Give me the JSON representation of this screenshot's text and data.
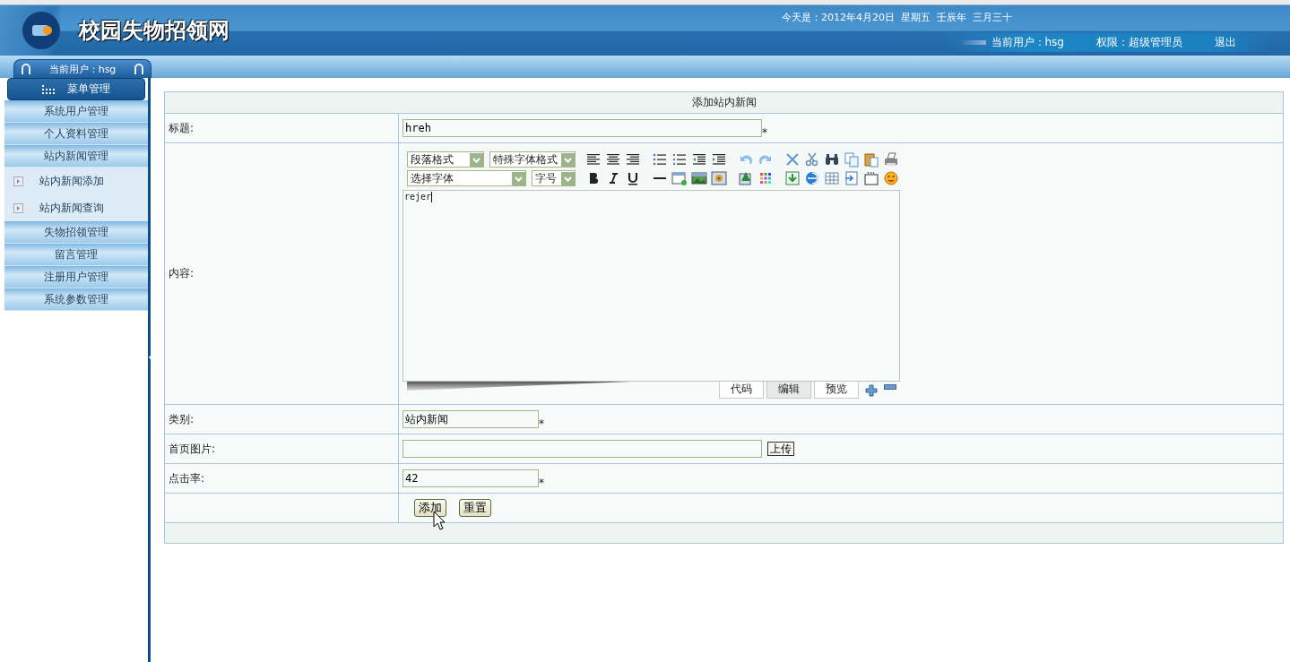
{
  "header": {
    "site_title": "校园失物招领网",
    "date_line": "今天是：2012年4月20日  星期五  壬辰年  三月三十",
    "current_user": "当前用户：hsg",
    "role": "权限：超级管理员",
    "logout": "退出"
  },
  "sidebar": {
    "user_tab": "当前用户：hsg",
    "menu_title": "菜单管理",
    "items": [
      {
        "label": "系统用户管理",
        "kind": "group"
      },
      {
        "label": "个人资料管理",
        "kind": "group"
      },
      {
        "label": "站内新闻管理",
        "kind": "group"
      },
      {
        "label": "站内新闻添加",
        "kind": "sub"
      },
      {
        "label": "站内新闻查询",
        "kind": "sub"
      },
      {
        "label": "失物招领管理",
        "kind": "group"
      },
      {
        "label": "留言管理",
        "kind": "group"
      },
      {
        "label": "注册用户管理",
        "kind": "group"
      },
      {
        "label": "系统参数管理",
        "kind": "group"
      }
    ]
  },
  "form": {
    "title": "添加站内新闻",
    "rows": [
      {
        "label": "标题:",
        "kind": "text",
        "value": "hreh",
        "required": true
      },
      {
        "label": "内容:",
        "kind": "editor"
      },
      {
        "label": "类别:",
        "kind": "text",
        "value": "站内新闻",
        "required": true
      },
      {
        "label": "首页图片:",
        "kind": "upload",
        "value": "",
        "button": "上传"
      },
      {
        "label": "点击率:",
        "kind": "text",
        "value": "42",
        "required": true
      }
    ],
    "required_mark": "*",
    "buttons": [
      "添加",
      "重置"
    ]
  },
  "editor": {
    "selects": [
      {
        "value": "段落格式"
      },
      {
        "value": "特殊字体格式"
      },
      {
        "value": "选择字体"
      },
      {
        "value": "字号"
      }
    ],
    "content": "rejer",
    "tabs": [
      {
        "label": "代码",
        "selected": false
      },
      {
        "label": "编辑",
        "selected": true
      },
      {
        "label": "预览",
        "selected": false
      }
    ]
  }
}
